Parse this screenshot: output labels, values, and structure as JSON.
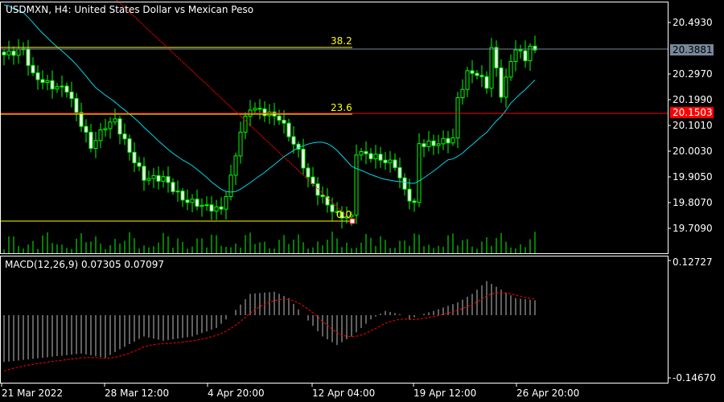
{
  "header": {
    "title": "USDMXN, H4:  United States Dollar vs Mexican Peso"
  },
  "colors": {
    "bull": "#00ff00",
    "ma": "#00d8e8",
    "fib": "#ffff00",
    "trend": "#ff0000",
    "bid": "#778899",
    "ask": "#ff0000",
    "macd_hist": "#c0c0c0",
    "macd_signal": "#ff0000"
  },
  "price_axis": {
    "ticks": [
      "20.4930",
      "20.2970",
      "20.1990",
      "20.1010",
      "20.0030",
      "19.9050",
      "19.8070",
      "19.7090"
    ],
    "bid_label": "20.3881",
    "ask_label": "20.1503"
  },
  "fibonacci": {
    "levels": [
      "38.2",
      "23.6",
      "0.0"
    ]
  },
  "macd": {
    "label": "MACD(12,26,9) 0.07305 0.07097",
    "axis_top": "0.12727",
    "axis_bottom": "-0.14670"
  },
  "time_axis": {
    "labels": [
      "21 Mar 2022",
      "28 Mar 12:00",
      "4 Apr 20:00",
      "12 Apr 04:00",
      "19 Apr 12:00",
      "26 Apr 20:00"
    ]
  },
  "chart_data": {
    "type": "candlestick",
    "symbol": "USDMXN",
    "timeframe": "H4",
    "candle_count": 111,
    "close_keypoints": [
      [
        0,
        20.37
      ],
      [
        4,
        20.39
      ],
      [
        6,
        20.29
      ],
      [
        10,
        20.25
      ],
      [
        13,
        20.24
      ],
      [
        15,
        20.15
      ],
      [
        18,
        20.02
      ],
      [
        21,
        20.1
      ],
      [
        23,
        20.12
      ],
      [
        26,
        20.0
      ],
      [
        29,
        19.9
      ],
      [
        33,
        19.9
      ],
      [
        37,
        19.82
      ],
      [
        42,
        19.79
      ],
      [
        45,
        19.78
      ],
      [
        47,
        19.9
      ],
      [
        49,
        20.08
      ],
      [
        51,
        20.17
      ],
      [
        54,
        20.15
      ],
      [
        57,
        20.13
      ],
      [
        61,
        20.0
      ],
      [
        63,
        19.9
      ],
      [
        66,
        19.82
      ],
      [
        69,
        19.76
      ],
      [
        72,
        19.75
      ],
      [
        73,
        20.0
      ],
      [
        77,
        19.98
      ],
      [
        81,
        19.95
      ],
      [
        83,
        19.85
      ],
      [
        85,
        19.8
      ],
      [
        86,
        20.03
      ],
      [
        89,
        20.03
      ],
      [
        93,
        20.05
      ],
      [
        94,
        20.2
      ],
      [
        96,
        20.3
      ],
      [
        98,
        20.3
      ],
      [
        100,
        20.25
      ],
      [
        101,
        20.4
      ],
      [
        103,
        20.22
      ],
      [
        104,
        20.28
      ],
      [
        106,
        20.4
      ],
      [
        108,
        20.35
      ],
      [
        109,
        20.41
      ],
      [
        110,
        20.388
      ]
    ],
    "macd_hist_keypoints": [
      [
        0,
        -0.11
      ],
      [
        8,
        -0.1
      ],
      [
        16,
        -0.09
      ],
      [
        21,
        -0.1
      ],
      [
        24,
        -0.08
      ],
      [
        29,
        -0.05
      ],
      [
        33,
        -0.06
      ],
      [
        39,
        -0.05
      ],
      [
        44,
        -0.03
      ],
      [
        47,
        0.0
      ],
      [
        51,
        0.05
      ],
      [
        56,
        0.055
      ],
      [
        59,
        0.04
      ],
      [
        62,
        0.0
      ],
      [
        66,
        -0.05
      ],
      [
        69,
        -0.07
      ],
      [
        72,
        -0.05
      ],
      [
        76,
        -0.01
      ],
      [
        79,
        0.01
      ],
      [
        83,
        0.0
      ],
      [
        84,
        -0.01
      ],
      [
        86,
        0.0
      ],
      [
        89,
        0.01
      ],
      [
        94,
        0.03
      ],
      [
        97,
        0.05
      ],
      [
        100,
        0.08
      ],
      [
        103,
        0.06
      ],
      [
        106,
        0.04
      ],
      [
        110,
        0.035
      ]
    ],
    "price_range": [
      19.709,
      20.493
    ],
    "macd_range": [
      -0.1467,
      0.12727
    ]
  }
}
